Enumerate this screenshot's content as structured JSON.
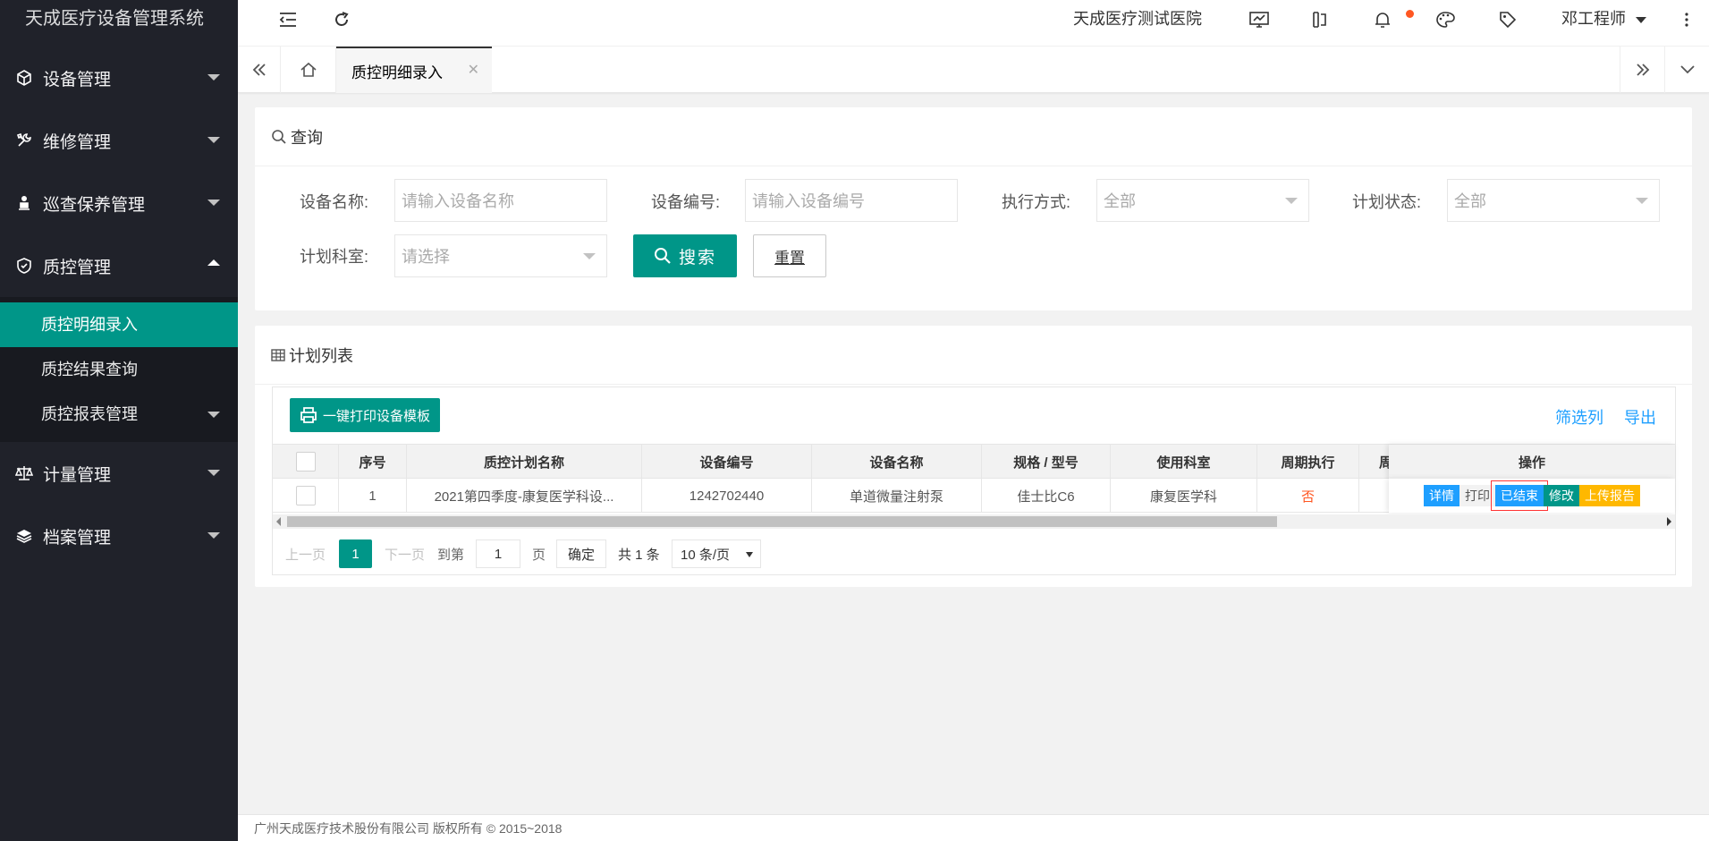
{
  "app": {
    "title": "天成医疗设备管理系统"
  },
  "header": {
    "hospital": "天成医疗测试医院",
    "user": "邓工程师"
  },
  "sidebar": {
    "items": [
      {
        "label": "设备管理",
        "icon": "cube-icon"
      },
      {
        "label": "维修管理",
        "icon": "wrench-icon"
      },
      {
        "label": "巡查保养管理",
        "icon": "inspector-icon"
      },
      {
        "label": "质控管理",
        "icon": "shield-icon"
      },
      {
        "label": "计量管理",
        "icon": "scale-icon"
      },
      {
        "label": "档案管理",
        "icon": "layers-icon"
      }
    ],
    "sub_items": [
      "质控明细录入",
      "质控结果查询",
      "质控报表管理"
    ]
  },
  "tabs": {
    "active": "质控明细录入"
  },
  "query": {
    "title": "查询",
    "device_name_label": "设备名称:",
    "device_name_placeholder": "请输入设备名称",
    "device_no_label": "设备编号:",
    "device_no_placeholder": "请输入设备编号",
    "exec_label": "执行方式:",
    "exec_value": "全部",
    "status_label": "计划状态:",
    "status_value": "全部",
    "dept_label": "计划科室:",
    "dept_placeholder": "请选择",
    "search_btn": "搜索",
    "reset_btn": "重置"
  },
  "plan": {
    "title": "计划列表",
    "print_btn": "一键打印设备模板",
    "filter_link": "筛选列",
    "export_link": "导出",
    "columns": [
      "序号",
      "质控计划名称",
      "设备编号",
      "设备名称",
      "规格 / 型号",
      "使用科室",
      "周期执行",
      "周",
      "操作"
    ],
    "rows": [
      {
        "index": "1",
        "plan_name": "2021第四季度-康复医学科设...",
        "device_no": "1242702440",
        "device_name": "单道微量注射泵",
        "model": "佳士比C6",
        "dept": "康复医学科",
        "periodic": "否"
      }
    ],
    "ops": {
      "detail": "详情",
      "print": "打印",
      "finished": "已结束",
      "edit": "修改",
      "upload": "上传报告"
    }
  },
  "pager": {
    "prev": "上一页",
    "current": "1",
    "next": "下一页",
    "goto": "到第",
    "goto_value": "1",
    "page_unit": "页",
    "confirm": "确定",
    "total": "共 1 条",
    "page_size": "10 条/页"
  },
  "footer": {
    "copyright": "广州天成医疗技术股份有限公司 版权所有 © 2015~2018"
  },
  "colors": {
    "primary": "#009688",
    "sidebar": "#20222a",
    "blue": "#1e9fff",
    "orange": "#ffb800",
    "red": "#ff5722"
  }
}
